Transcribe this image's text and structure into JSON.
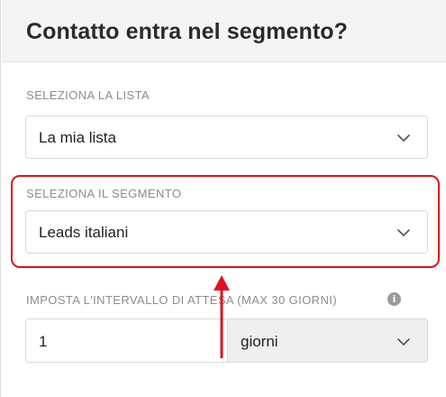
{
  "header": {
    "title": "Contatto entra nel segmento?"
  },
  "list_field": {
    "label": "SELEZIONA LA LISTA",
    "value": "La mia lista"
  },
  "segment_field": {
    "label": "SELEZIONA IL SEGMENTO",
    "value": "Leads italiani"
  },
  "interval_field": {
    "label": "IMPOSTA L'INTERVALLO DI ATTESA (MAX 30 GIORNI)",
    "value": "1",
    "unit": "giorni",
    "info_icon": "info-icon"
  },
  "annotation": {
    "highlight_color": "#e0101b",
    "arrow_color": "#e0101b"
  }
}
